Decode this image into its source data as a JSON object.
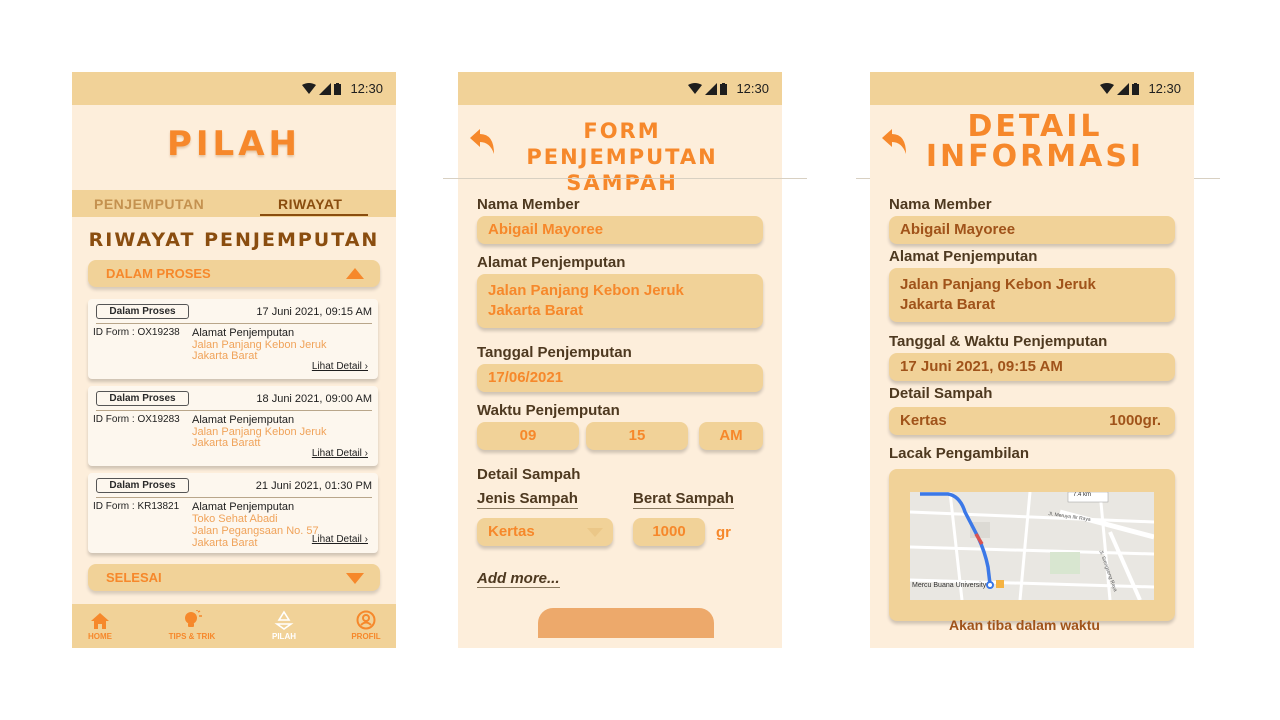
{
  "status": {
    "time": "12:30"
  },
  "phone1": {
    "app_title": "PILAH",
    "tabs": {
      "pickup": "PENJEMPUTAN",
      "history": "RIWAYAT"
    },
    "section_title": "RIWAYAT PENJEMPUTAN",
    "in_process_label": "DALAM PROSES",
    "done_label": "SELESAI",
    "cards": [
      {
        "status": "Dalam Proses",
        "date": "17 Juni 2021, 09:15 AM",
        "id": "ID Form : OX19238",
        "addr_label": "Alamat Penjemputan",
        "addr1": "Jalan Panjang Kebon Jeruk",
        "addr2": "Jakarta Barat",
        "addr3": "",
        "link": "Lihat Detail ›"
      },
      {
        "status": "Dalam Proses",
        "date": "18 Juni 2021, 09:00 AM",
        "id": "ID Form : OX19283",
        "addr_label": "Alamat Penjemputan",
        "addr1": "Jalan Panjang Kebon Jeruk",
        "addr2": "Jakarta Baratt",
        "addr3": "",
        "link": "Lihat Detail ›"
      },
      {
        "status": "Dalam Proses",
        "date": "21 Juni 2021, 01:30 PM",
        "id": "ID Form : KR13821",
        "addr_label": "Alamat Penjemputan",
        "addr1": "Toko Sehat Abadi",
        "addr2": "Jalan Pegangsaan No. 57",
        "addr3": "Jakarta Barat",
        "link": "Lihat Detail ›"
      }
    ],
    "nav": [
      {
        "label": "HOME",
        "icon": "home-icon"
      },
      {
        "label": "TIPS & TRIK",
        "icon": "lightbulb-icon"
      },
      {
        "label": "PILAH",
        "icon": "recycle-icon"
      },
      {
        "label": "PROFIL",
        "icon": "profile-icon"
      }
    ]
  },
  "phone2": {
    "title_line1": "FORM PENJEMPUTAN",
    "title_line2": "SAMPAH",
    "member_label": "Nama Member",
    "member_value": "Abigail Mayoree",
    "address_label": "Alamat Penjemputan",
    "address_line1": "Jalan Panjang Kebon Jeruk",
    "address_line2": "Jakarta Barat",
    "date_label": "Tanggal Penjemputan",
    "date_value": "17/06/2021",
    "time_label": "Waktu Penjemputan",
    "time_hour": "09",
    "time_minute": "15",
    "time_ampm": "AM",
    "detail_label": "Detail Sampah",
    "type_label": "Jenis Sampah",
    "weight_label": "Berat Sampah",
    "type_value": "Kertas",
    "weight_value": "1000",
    "weight_unit": "gr",
    "add_more": "Add more..."
  },
  "phone3": {
    "title_line1": "DETAIL",
    "title_line2": "INFORMASI",
    "member_label": "Nama Member",
    "member_value": "Abigail Mayoree",
    "address_label": "Alamat Penjemputan",
    "address_line1": "Jalan Panjang Kebon Jeruk",
    "address_line2": "Jakarta Barat",
    "datetime_label": "Tanggal & Waktu Penjemputan",
    "datetime_value": "17 Juni 2021, 09:15 AM",
    "detail_label": "Detail Sampah",
    "detail_type": "Kertas",
    "detail_weight": "1000gr.",
    "track_label": "Lacak Pengambilan",
    "map_distance": "7.4 km",
    "map_poi": "Mercu Buana University",
    "map_street1": "Jl. Meruya Ilir Raya",
    "map_street2": "Jl. Srengseng Raya",
    "eta_text": "Akan tiba dalam waktu"
  },
  "colors": {
    "accent": "#f6882b",
    "bar": "#f1d298",
    "bg": "#fdeedb",
    "brown": "#8a4d0f"
  }
}
